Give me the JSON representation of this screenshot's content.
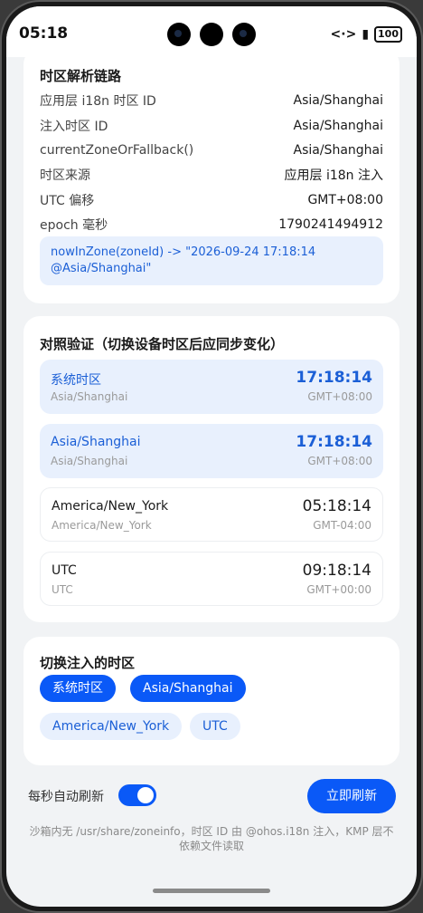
{
  "status": {
    "time": "05:18",
    "code_icon": "<·>",
    "battery": "100"
  },
  "chain": {
    "title": "时区解析链路",
    "rows": [
      {
        "key": "应用层 i18n 时区 ID",
        "value": "Asia/Shanghai"
      },
      {
        "key": "注入时区 ID",
        "value": "Asia/Shanghai"
      },
      {
        "key": "currentZoneOrFallback()",
        "value": "Asia/Shanghai"
      },
      {
        "key": "时区来源",
        "value": "应用层 i18n 注入"
      },
      {
        "key": "UTC 偏移",
        "value": "GMT+08:00"
      },
      {
        "key": "epoch 毫秒",
        "value": "1790241494912"
      }
    ],
    "code": "nowInZone(zoneId) -> \"2026-09-24 17:18:14 @Asia/Shanghai\""
  },
  "compare": {
    "title": "对照验证（切换设备时区后应同步变化）",
    "items": [
      {
        "name": "系统时区",
        "sub": "Asia/Shanghai",
        "time": "17:18:14",
        "offset": "GMT+08:00",
        "highlight": true
      },
      {
        "name": "Asia/Shanghai",
        "sub": "Asia/Shanghai",
        "time": "17:18:14",
        "offset": "GMT+08:00",
        "highlight": true
      },
      {
        "name": "America/New_York",
        "sub": "America/New_York",
        "time": "05:18:14",
        "offset": "GMT-04:00",
        "highlight": false
      },
      {
        "name": "UTC",
        "sub": "UTC",
        "time": "09:18:14",
        "offset": "GMT+00:00",
        "highlight": false
      }
    ]
  },
  "switcher": {
    "title": "切换注入的时区",
    "chips": [
      {
        "label": "系统时区",
        "selected": true
      },
      {
        "label": "Asia/Shanghai",
        "selected": true
      },
      {
        "label": "America/New_York",
        "selected": false
      },
      {
        "label": "UTC",
        "selected": false
      }
    ]
  },
  "bottom": {
    "auto_refresh_label": "每秒自动刷新",
    "auto_refresh_on": true,
    "refresh_button": "立即刷新",
    "footnote": "沙箱内无 /usr/share/zoneinfo，时区 ID 由 @ohos.i18n 注入，KMP 层不依赖文件读取"
  },
  "colors": {
    "accent": "#0a59f7",
    "highlight_bg": "#e8f0fd",
    "page_bg": "#f1f3f5"
  }
}
